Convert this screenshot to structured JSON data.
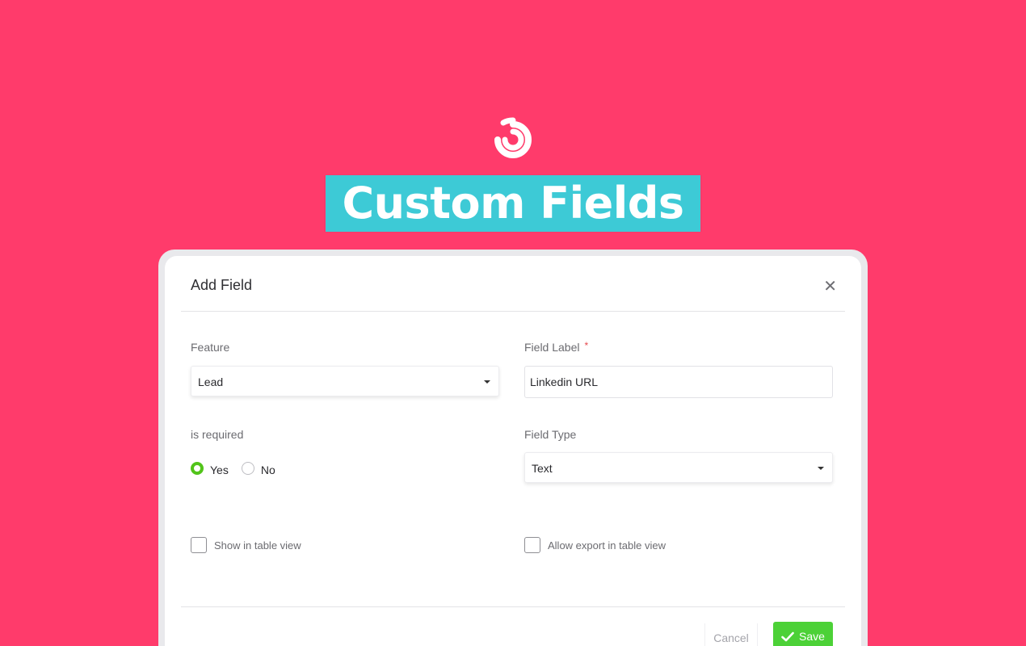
{
  "brand": {
    "logo_icon": "swirl-logo-icon",
    "banner_text": "Custom Fields",
    "background_color": "#FF3B6B",
    "banner_color": "#3DCAD6"
  },
  "modal": {
    "title": "Add Field",
    "close_icon": "close-icon",
    "close_glyph": "✕",
    "feature": {
      "label": "Feature",
      "value": "Lead"
    },
    "field_label": {
      "label": "Field Label",
      "required_mark": "*",
      "value": "Linkedin URL"
    },
    "is_required": {
      "label": "is required",
      "options": [
        "Yes",
        "No"
      ],
      "selected": "Yes"
    },
    "field_type": {
      "label": "Field Type",
      "value": "Text"
    },
    "show_in_table_view": {
      "label": "Show in table view",
      "checked": false
    },
    "allow_export": {
      "label": "Allow export in table view",
      "checked": false
    },
    "footer": {
      "cancel_label": "Cancel",
      "save_label": "Save",
      "save_icon": "check-icon",
      "save_color": "#4CD137"
    }
  }
}
